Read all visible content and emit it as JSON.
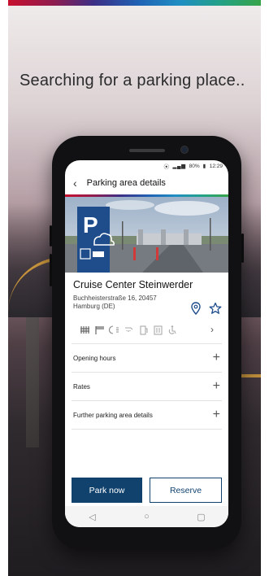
{
  "headline": "Searching for a parking place..",
  "status_bar": {
    "battery": "80%",
    "time": "12:29"
  },
  "header": {
    "title": "Parking area details",
    "back_icon": "chevron-left-icon"
  },
  "place": {
    "name": "Cruise Center Steinwerder",
    "street": "Buchheisterstraße 16, 20457",
    "city": "Hamburg (DE)",
    "pin_icon": "map-pin-icon",
    "favorite_icon": "star-icon"
  },
  "amenities": [
    "truck-parking-icon",
    "barrier-icon",
    "lighting-icon",
    "shower-icon",
    "fuel-icon",
    "restaurant-icon",
    "accessibility-icon"
  ],
  "sections": [
    {
      "label": "Opening hours"
    },
    {
      "label": "Rates"
    },
    {
      "label": "Further parking area details"
    }
  ],
  "actions": {
    "primary": "Park now",
    "secondary": "Reserve"
  },
  "colors": {
    "brand_dark_blue": "#11426e",
    "stripe_red": "#c8102e",
    "stripe_purple": "#3b2f86",
    "stripe_blue": "#1f63b5",
    "stripe_teal": "#1f8fc3",
    "stripe_green": "#38a449",
    "icon_blue": "#1f4d8c"
  }
}
